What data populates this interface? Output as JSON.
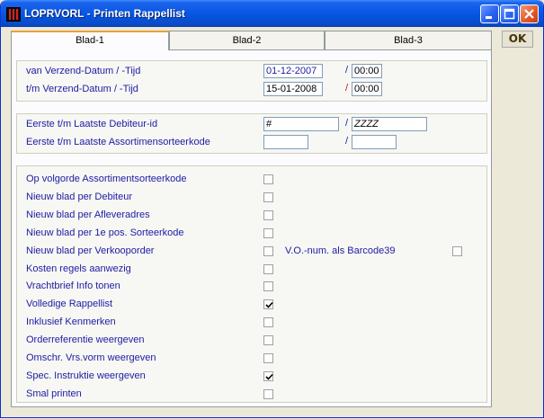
{
  "window": {
    "title": "LOPRVORL - Printen Rappellist"
  },
  "tabs": [
    {
      "label": "Blad-1",
      "active": true
    },
    {
      "label": "Blad-2",
      "active": false
    },
    {
      "label": "Blad-3",
      "active": false
    }
  ],
  "ok_label": "OK",
  "dates": {
    "from_label": "van Verzend-Datum / -Tijd",
    "from_date": "01-12-2007",
    "from_time": "00:00",
    "to_label": "t/m Verzend-Datum / -Tijd",
    "to_date": "15-01-2008",
    "to_time": "00:00"
  },
  "ranges": {
    "debtor_label": "Eerste t/m Laatste Debiteur-id",
    "debtor_from": "#",
    "debtor_to": "ZZZZ",
    "assort_label": "Eerste t/m Laatste Assortimensorteerkode",
    "assort_from": "",
    "assort_to": ""
  },
  "slash": "/",
  "options": [
    {
      "label": "Op volgorde Assortimentsorteerkode",
      "checked": false
    },
    {
      "label": "Nieuw blad per Debiteur",
      "checked": false
    },
    {
      "label": "Nieuw blad per Afleveradres",
      "checked": false
    },
    {
      "label": "Nieuw blad per 1e pos. Sorteerkode",
      "checked": false
    },
    {
      "label": "Nieuw blad per Verkooporder",
      "checked": false
    },
    {
      "label": "Kosten regels aanwezig",
      "checked": false
    },
    {
      "label": "Vrachtbrief Info tonen",
      "checked": false
    },
    {
      "label": "Volledige Rappellist",
      "checked": true
    },
    {
      "label": "Inklusief Kenmerken",
      "checked": false
    },
    {
      "label": "Orderreferentie weergeven",
      "checked": false
    },
    {
      "label": "Omschr. Vrs.vorm weergeven",
      "checked": false
    },
    {
      "label": "Spec. Instruktie weergeven",
      "checked": true
    },
    {
      "label": "Smal printen",
      "checked": false
    }
  ],
  "barcode_option": {
    "label": "V.O.-num. als Barcode39",
    "checked": false
  }
}
